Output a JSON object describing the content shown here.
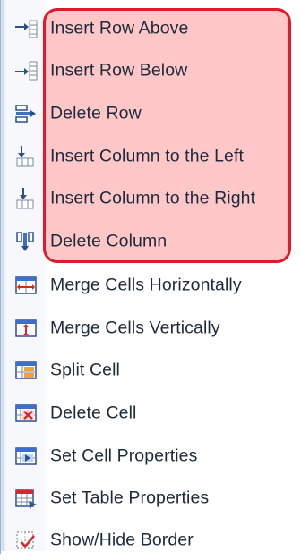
{
  "menu": {
    "items": [
      {
        "label": "Insert Row Above",
        "icon": "insert-row-above-icon"
      },
      {
        "label": "Insert Row Below",
        "icon": "insert-row-below-icon"
      },
      {
        "label": "Delete Row",
        "icon": "delete-row-icon"
      },
      {
        "label": "Insert Column to the Left",
        "icon": "insert-column-left-icon"
      },
      {
        "label": "Insert Column to the Right",
        "icon": "insert-column-right-icon"
      },
      {
        "label": "Delete Column",
        "icon": "delete-column-icon"
      },
      {
        "label": "Merge Cells Horizontally",
        "icon": "merge-cells-horizontally-icon"
      },
      {
        "label": "Merge Cells Vertically",
        "icon": "merge-cells-vertically-icon"
      },
      {
        "label": "Split Cell",
        "icon": "split-cell-icon"
      },
      {
        "label": "Delete Cell",
        "icon": "delete-cell-icon"
      },
      {
        "label": "Set Cell Properties",
        "icon": "set-cell-properties-icon"
      },
      {
        "label": "Set Table Properties",
        "icon": "set-table-properties-icon"
      },
      {
        "label": "Show/Hide Border",
        "icon": "show-hide-border-icon"
      }
    ]
  },
  "colors": {
    "highlight_border": "#e0192b",
    "highlight_fill": "#ff9999",
    "text": "#1d2a3c",
    "icon_blue": "#3b6fc9",
    "icon_red": "#d9262a"
  }
}
